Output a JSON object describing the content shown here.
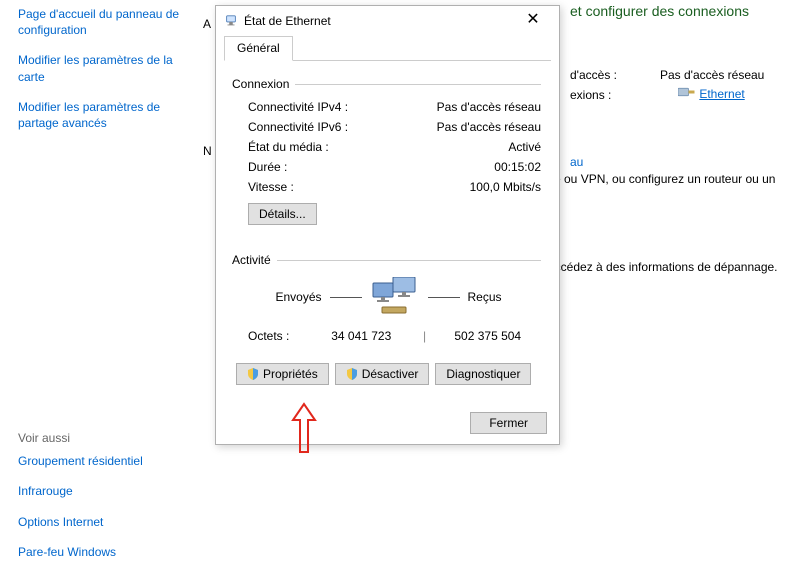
{
  "sidebar": {
    "links": {
      "home": "Page d'accueil du panneau de configuration",
      "adapter": "Modifier les paramètres de la carte",
      "sharing": "Modifier les paramètres de partage avancés"
    },
    "see_also_label": "Voir aussi",
    "see_also": {
      "homegroup": "Groupement résidentiel",
      "infrared": "Infrarouge",
      "internet": "Options Internet",
      "firewall": "Pare-feu Windows"
    }
  },
  "bg": {
    "head_partial": "et configurer des connexions",
    "access_label": "d'accès :",
    "access_val": "Pas d'accès réseau",
    "conn_label": "exions :",
    "conn_link": "Ethernet",
    "bau": "au",
    "info1": "ce ou VPN, ou configurez un routeur ou un",
    "info2": "accédez à des informations de dépannage.",
    "truncA": "A",
    "truncN": "N"
  },
  "dialog": {
    "title": "État de Ethernet",
    "tab": "Général",
    "close": "✕",
    "groups": {
      "connection": "Connexion",
      "activity": "Activité"
    },
    "connection": {
      "ipv4_k": "Connectivité IPv4 :",
      "ipv4_v": "Pas d'accès réseau",
      "ipv6_k": "Connectivité IPv6 :",
      "ipv6_v": "Pas d'accès réseau",
      "media_k": "État du média :",
      "media_v": "Activé",
      "dur_k": "Durée :",
      "dur_v": "00:15:02",
      "speed_k": "Vitesse :",
      "speed_v": "100,0 Mbits/s"
    },
    "details_btn": "Détails...",
    "activity": {
      "sent_label": "Envoyés",
      "recv_label": "Reçus",
      "bytes_label": "Octets :",
      "sent_bytes": "34 041 723",
      "recv_bytes": "502 375 504",
      "sep": "|"
    },
    "actions": {
      "properties": "Propriétés",
      "disable": "Désactiver",
      "diagnose": "Diagnostiquer"
    },
    "close_btn": "Fermer"
  }
}
